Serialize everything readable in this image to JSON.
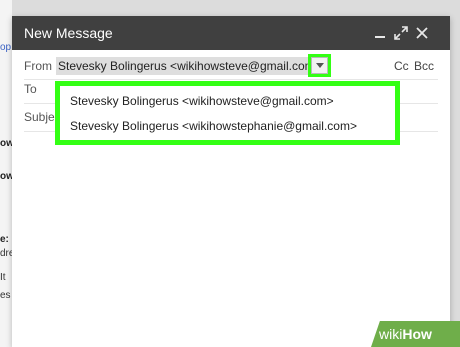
{
  "background_page": {
    "fragments": [
      "op",
      "ow",
      "ow",
      "e:",
      "dre",
      "It",
      "es"
    ]
  },
  "compose": {
    "title": "New Message",
    "header_icons": [
      "minimize-icon",
      "expand-icon",
      "close-icon"
    ],
    "from": {
      "label": "From",
      "value": "Stevesky Bolingerus <wikihowsteve@gmail.com>"
    },
    "to": {
      "label": "To"
    },
    "subject": {
      "label": "Subje"
    },
    "cc_bcc": "Cc Bcc",
    "from_options": [
      "Stevesky Bolingerus <wikihowsteve@gmail.com>",
      "Stevesky Bolingerus <wikihowstephanie@gmail.com>"
    ]
  },
  "watermark": {
    "part1": "wiki",
    "part2": "How"
  },
  "colors": {
    "header": "#404040",
    "highlight": "#33ff14",
    "from_field_bg": "#dedede"
  }
}
